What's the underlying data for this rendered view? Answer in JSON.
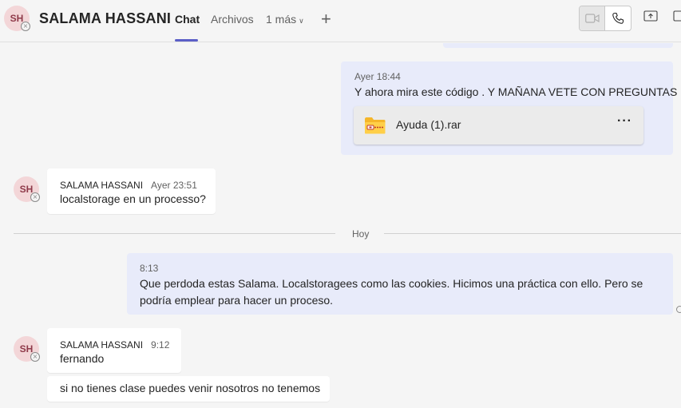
{
  "header": {
    "avatar_initials": "SH",
    "contact_name": "SALAMA HASSANI",
    "tabs": [
      {
        "label": "Chat"
      },
      {
        "label": "Archivos"
      },
      {
        "label": "1 más"
      }
    ],
    "icons": [
      "video-call-icon",
      "audio-call-icon",
      "share-screen-icon",
      "pop-out-icon",
      "add-tab-icon"
    ]
  },
  "conversation": {
    "messages": [
      {
        "time": "Ayer 18:44",
        "text": "Y ahora mira este código . Y MAÑANA VETE CON PREGUNTAS",
        "attachment": {
          "name": "Ayuda (1).rar",
          "more": "···"
        }
      },
      {
        "sender": "SALAMA HASSANI",
        "avatar_initials": "SH",
        "time": "Ayer 23:51",
        "text": "localstorage en un processo?"
      },
      {
        "time": "8:13",
        "text": "Que perdoda estas Salama. Localstoragees como las cookies. Hicimos una práctica con ello. Pero se podría emplear para hacer un proceso."
      },
      {
        "sender": "SALAMA HASSANI",
        "avatar_initials": "SH",
        "time": "9:12",
        "text": "fernando"
      },
      {
        "text": "si no tienes clase puedes venir nosotros no tenemos"
      }
    ],
    "day_divider": "Hoy"
  },
  "colors": {
    "accent": "#5b5fc7",
    "own_bubble": "#e8ebfa",
    "other_bubble": "#ffffff",
    "background": "#f5f5f5",
    "avatar_bg": "#f3d6d8",
    "avatar_text": "#8f3a4a"
  }
}
